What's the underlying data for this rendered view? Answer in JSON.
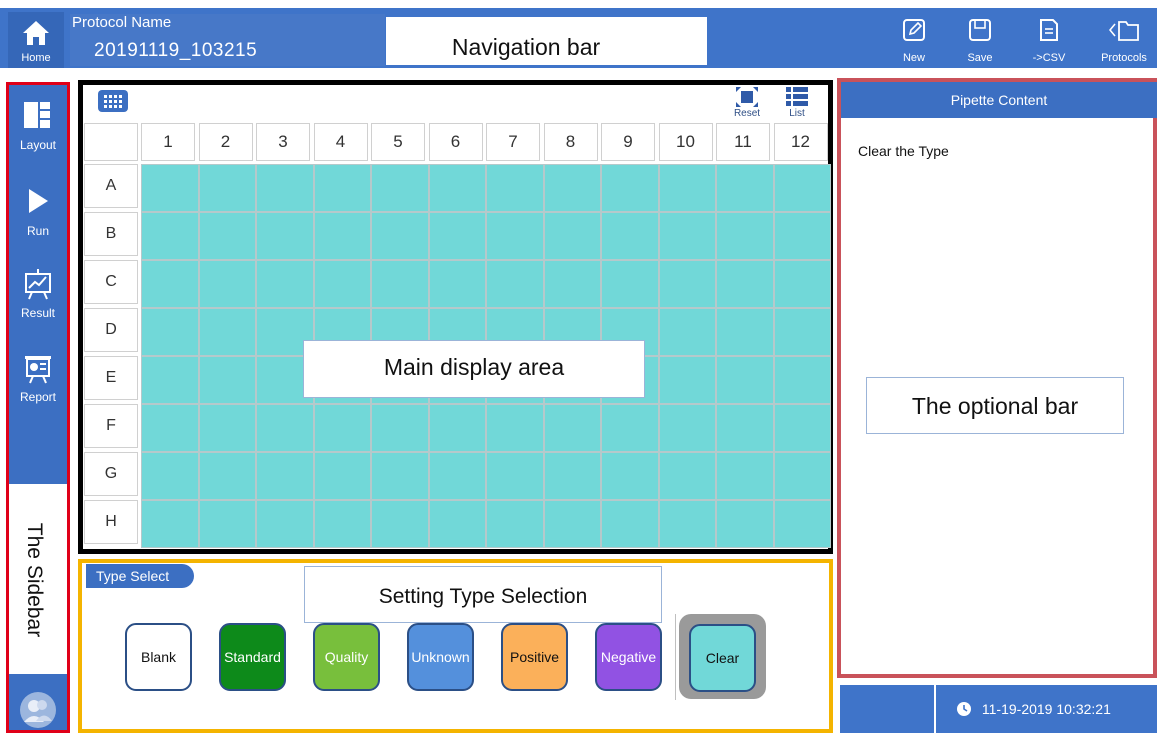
{
  "header": {
    "home_label": "Home",
    "protocol_label": "Protocol Name",
    "protocol_value": "20191119_103215",
    "callout": "Navigation bar",
    "tools": [
      {
        "label": "New",
        "icon": "edit-icon"
      },
      {
        "label": "Save",
        "icon": "save-icon"
      },
      {
        "label": "->CSV",
        "icon": "csv-icon"
      },
      {
        "label": "Protocols",
        "icon": "folder-back-icon"
      }
    ]
  },
  "sidebar": {
    "items": [
      {
        "label": "Layout",
        "icon": "layout-icon"
      },
      {
        "label": "Run",
        "icon": "play-icon"
      },
      {
        "label": "Result",
        "icon": "chart-icon"
      },
      {
        "label": "Report",
        "icon": "report-icon"
      }
    ],
    "callout": "The Sidebar"
  },
  "plate": {
    "reset_label": "Reset",
    "list_label": "List",
    "columns": [
      "1",
      "2",
      "3",
      "4",
      "5",
      "6",
      "7",
      "8",
      "9",
      "10",
      "11",
      "12"
    ],
    "rows": [
      "A",
      "B",
      "C",
      "D",
      "E",
      "F",
      "G",
      "H"
    ],
    "callout": "Main display area",
    "well_color": "#71d8d8"
  },
  "type_select": {
    "tab_label": "Type Select",
    "callout": "Setting Type Selection",
    "buttons": [
      {
        "label": "Blank",
        "color": "#ffffff",
        "text_color": "#111111"
      },
      {
        "label": "Standard",
        "color": "#0d8a1a",
        "text_color": "#ffffff"
      },
      {
        "label": "Quality",
        "color": "#78bf3c",
        "text_color": "#ffffff"
      },
      {
        "label": "Unknown",
        "color": "#5490dc",
        "text_color": "#ffffff"
      },
      {
        "label": "Positive",
        "color": "#fbb05a",
        "text_color": "#111111"
      },
      {
        "label": "Negative",
        "color": "#9152e3",
        "text_color": "#ffffff"
      },
      {
        "label": "Clear",
        "color": "#71d8d8",
        "text_color": "#111111"
      }
    ]
  },
  "right_panel": {
    "header": "Pipette Content",
    "content": "Clear the Type",
    "callout": "The optional bar"
  },
  "status": {
    "datetime": "11-19-2019 10:32:21"
  }
}
